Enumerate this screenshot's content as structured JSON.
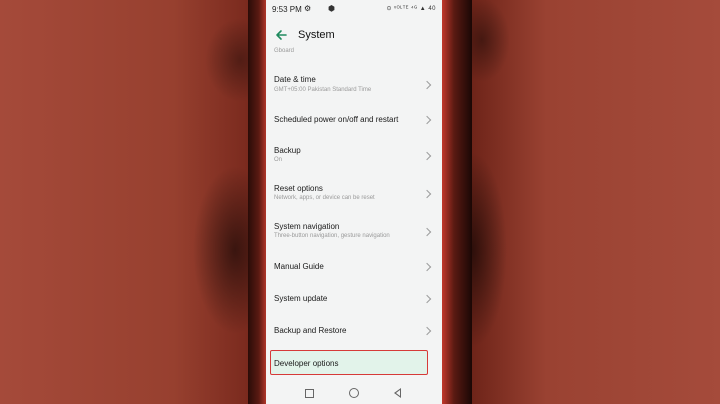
{
  "status_bar": {
    "time": "9:53 PM",
    "icons_left": [
      "settings-gear",
      "shield"
    ],
    "icons_right_text": "⊙ ᵛᴼᴸᵀᴱ ⁴ᴳ ▲ 40"
  },
  "header": {
    "title": "System",
    "above_item": "Gboard"
  },
  "items": [
    {
      "title": "Date & time",
      "subtitle": "GMT+05:00 Pakistan Standard Time"
    },
    {
      "title": "Scheduled power on/off and restart",
      "subtitle": ""
    },
    {
      "title": "Backup",
      "subtitle": "On"
    },
    {
      "title": "Reset options",
      "subtitle": "Network, apps, or device can be reset"
    },
    {
      "title": "System navigation",
      "subtitle": "Three-button navigation, gesture navigation"
    },
    {
      "title": "Manual Guide",
      "subtitle": ""
    },
    {
      "title": "System update",
      "subtitle": ""
    },
    {
      "title": "Backup and Restore",
      "subtitle": ""
    },
    {
      "title": "Developer options",
      "subtitle": ""
    }
  ],
  "colors": {
    "accent": "#1f8a5e",
    "highlight_bg": "#e2f3ea",
    "highlight_border": "#d63a38"
  }
}
